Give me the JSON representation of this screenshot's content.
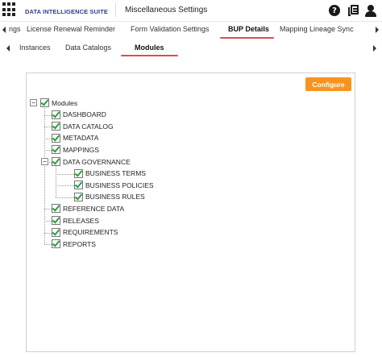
{
  "header": {
    "brand": "DATA INTELLIGENCE SUITE",
    "page_title": "Miscellaneous Settings",
    "icons": [
      "apps-grid-icon",
      "help-icon",
      "book-icon",
      "user-icon"
    ]
  },
  "tabs_row1": [
    {
      "label": "ngs",
      "active": false
    },
    {
      "label": "License Renewal Reminder",
      "active": false
    },
    {
      "label": "Form Validation Settings",
      "active": false
    },
    {
      "label": "BUP Details",
      "active": true
    },
    {
      "label": "Mapping Lineage Sync",
      "active": false
    }
  ],
  "tabs_row2": [
    {
      "label": "Instances",
      "active": false
    },
    {
      "label": "Data Catalogs",
      "active": false
    },
    {
      "label": "Modules",
      "active": true
    }
  ],
  "panel": {
    "configure_label": "Configure"
  },
  "tree": {
    "root": {
      "label": "Modules",
      "checked": true,
      "expander": "−"
    },
    "items": [
      {
        "label": "DASHBOARD",
        "checked": true
      },
      {
        "label": "DATA CATALOG",
        "checked": true
      },
      {
        "label": "METADATA",
        "checked": true
      },
      {
        "label": "MAPPINGS",
        "checked": true
      },
      {
        "label": "DATA GOVERNANCE",
        "checked": true,
        "expander": "−"
      },
      {
        "label": "BUSINESS TERMS",
        "checked": true
      },
      {
        "label": "BUSINESS POLICIES",
        "checked": true
      },
      {
        "label": "BUSINESS RULES",
        "checked": true
      },
      {
        "label": "REFERENCE DATA",
        "checked": true
      },
      {
        "label": "RELEASES",
        "checked": true
      },
      {
        "label": "REQUIREMENTS",
        "checked": true
      },
      {
        "label": "REPORTS",
        "checked": true
      }
    ]
  },
  "colors": {
    "accent_orange": "#f7941d",
    "tab_underline": "#e24b4b",
    "brand_blue": "#2d3e8c",
    "check_green": "#2a9d3a"
  }
}
